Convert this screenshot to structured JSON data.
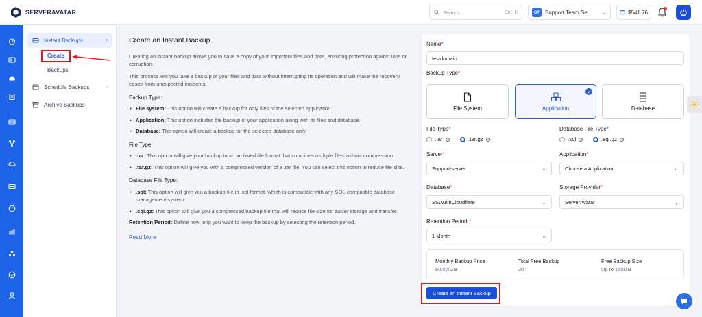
{
  "brand": {
    "name": "SERVERAVATAR"
  },
  "header": {
    "search_placeholder": "Search...",
    "search_shortcut": "Ctrl+K",
    "team_initials": "ST",
    "team_name": "Support Team Se...",
    "balance": "$541.76"
  },
  "submenu": {
    "instant_backups": "Instant Backups",
    "create": "Create",
    "backups": "Backups",
    "schedule_backups": "Schedule Backups",
    "archive_backups": "Archive Backups"
  },
  "description": {
    "title": "Create an Instant Backup",
    "intro1": "Creating an instant backup allows you to save a copy of your important files and data, ensuring protection against loss or corruption.",
    "intro2": "This process lets you take a backup of your files and data without interrupting its operation and will make the recovery easier from unexpected incidents.",
    "backup_type_heading": "Backup Type:",
    "backup_types": [
      {
        "term": "File system:",
        "text": " This option will create a backup for only files of the selected application."
      },
      {
        "term": "Application:",
        "text": " This option includes the backup of your application along with its files and database."
      },
      {
        "term": "Database:",
        "text": " This option will create a backup for the selected database only."
      }
    ],
    "file_type_heading": "File Type:",
    "file_types": [
      {
        "term": ".tar:",
        "text": " This option will give your backup in an archived file format that combines multiple files without compression."
      },
      {
        "term": ".tar.gz:",
        "text": " This option will give you with a compressed version of a .tar file. You can select this option to reduce file size."
      }
    ],
    "db_file_type_heading": "Database File Type:",
    "db_file_types": [
      {
        "term": ".sql:",
        "text": " This option will give you a backup file in .sql format, which is compatible with any SQL-compatible database management system."
      },
      {
        "term": ".sql.gz:",
        "text": " This option will give you a compressed backup file that will reduce file size for easier storage and transfer."
      }
    ],
    "retention_term": "Retention Period:",
    "retention_text": " Define how long you want to keep the backup by selecting the retention period.",
    "read_more": "Read More"
  },
  "form": {
    "name_label": "Name",
    "name_value": "testdomain",
    "backup_type_label": "Backup Type",
    "backup_type_options": [
      "File System",
      "Application",
      "Database"
    ],
    "selected_backup_type": "Application",
    "file_type_label": "File Type",
    "file_type_options": [
      ".tar",
      ".tar.gz"
    ],
    "selected_file_type": ".tar.gz",
    "db_file_type_label": "Database File Type",
    "db_file_type_options": [
      ".sql",
      ".sql.gz"
    ],
    "selected_db_file_type": ".sql.gz",
    "server_label": "Server",
    "server_value": "Support-server",
    "application_label": "Application",
    "application_value": "Choose a Application",
    "database_label": "Database",
    "database_value": "SSLWithCloudflare",
    "storage_label": "Storage Provider",
    "storage_value": "ServerAvatar",
    "retention_label": "Retention Period",
    "retention_value": "1 Month",
    "price": {
      "monthly_label": "Monthly Backup Price",
      "monthly_value": "$0.07/GB",
      "free_label": "Total Free Backup",
      "free_value": "20",
      "size_label": "Free Backup Size",
      "size_value": "Up to 150MB"
    },
    "submit": "Create an Instant Backup"
  },
  "colors": {
    "accent": "#1d4ed8",
    "rail": "#1d63e8",
    "highlight": "#e01b1b"
  }
}
